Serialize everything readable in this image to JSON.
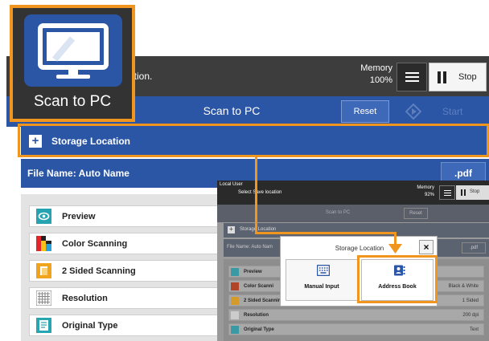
{
  "tile": {
    "label": "Scan to PC",
    "icon": "monitor-icon"
  },
  "topbar": {
    "message": "ation.",
    "memory_label": "Memory",
    "memory_value": "100%",
    "stop_label": "Stop"
  },
  "titlebar": {
    "title": "Scan to PC",
    "reset_label": "Reset",
    "start_label": "Start"
  },
  "storage": {
    "label": "Storage Location"
  },
  "file": {
    "label": "File Name: Auto Name",
    "ext": ".pdf"
  },
  "features": [
    {
      "label": "Preview",
      "icon": "preview-eye-icon"
    },
    {
      "label": "Color Scanning",
      "icon": "color-scanning-icon"
    },
    {
      "label": "2 Sided Scanning",
      "icon": "two-sided-icon"
    },
    {
      "label": "Resolution",
      "icon": "resolution-grid-icon"
    },
    {
      "label": "Original Type",
      "icon": "original-type-icon"
    }
  ],
  "inset": {
    "user": "Local User",
    "message": "Select Save location",
    "memory_label": "Memory",
    "memory_value": "92%",
    "stop_label": "Stop",
    "title": "Scan to PC",
    "reset_label": "Reset",
    "storage_label": "Storage Location",
    "file_label": "File Name: Auto Nam",
    "file_ext": ".pdf",
    "rows": [
      {
        "label": "Preview",
        "value": ""
      },
      {
        "label": "Color Scanni",
        "value": "Black & White"
      },
      {
        "label": "2 Sided Scanning",
        "value": "1 Sided"
      },
      {
        "label": "Resolution",
        "value": "200 dpi"
      },
      {
        "label": "Original Type",
        "value": "Text"
      }
    ]
  },
  "popup": {
    "title": "Storage Location",
    "close": "×",
    "manual_label": "Manual Input",
    "address_label": "Address Book"
  },
  "colors": {
    "accent": "#f0961e",
    "blue": "#2b55a5",
    "dark": "#3d3d3d"
  }
}
